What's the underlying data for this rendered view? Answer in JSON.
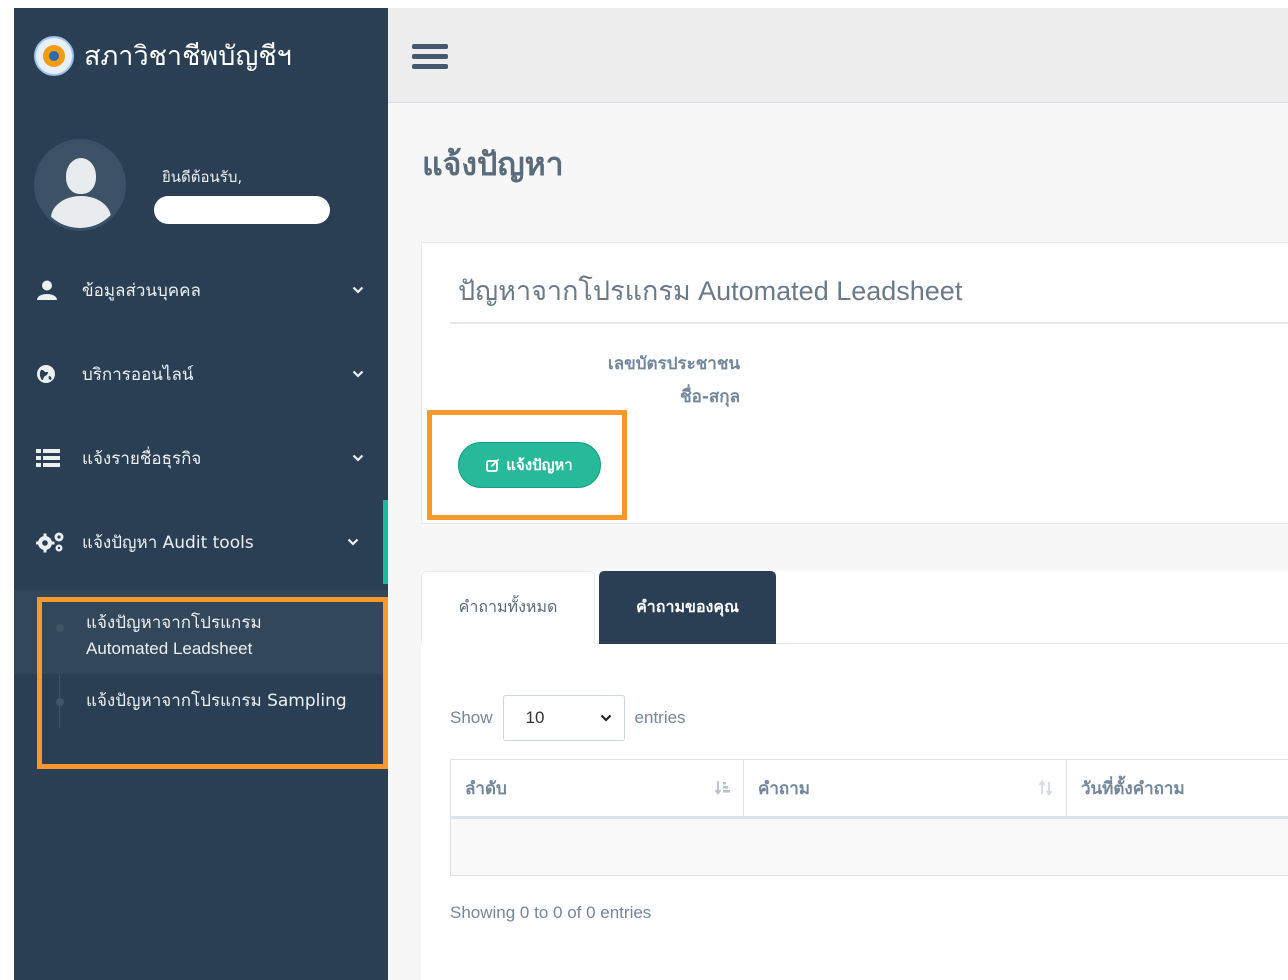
{
  "app": {
    "brand_title": "สภาวิชาชีพบัญชีฯ",
    "brand_icon": "logo-icon"
  },
  "profile": {
    "welcome": "ยินดีต้อนรับ,"
  },
  "sidebar": {
    "items": [
      {
        "label": "ข้อมูลส่วนบุคคล",
        "icon": "user-icon"
      },
      {
        "label": "บริการออนไลน์",
        "icon": "globe-icon"
      },
      {
        "label": "แจ้งรายชื่อธุรกิจ",
        "icon": "list-icon"
      },
      {
        "label": "แจ้งปัญหา Audit tools",
        "icon": "cogs-icon"
      }
    ],
    "submenu": [
      {
        "label_line1": "แจ้งปัญหาจากโปรแกรม",
        "label_line2": "Automated Leadsheet"
      },
      {
        "label": "แจ้งปัญหาจากโปรแกรม Sampling"
      }
    ]
  },
  "main": {
    "page_title": "แจ้งปัญหา",
    "panel_title": "ปัญหาจากโปรแกรม Automated Leadsheet",
    "field_id_label": "เลขบัตรประชาชน",
    "field_name_label": "ชื่อ-สกุล",
    "report_button": "แจ้งปัญหา"
  },
  "tabs": [
    {
      "label": "คำถามทั้งหมด"
    },
    {
      "label": "คำถามของคุณ"
    }
  ],
  "table": {
    "show_label": "Show",
    "entries_value": "10",
    "entries_label": "entries",
    "columns": [
      "ลำดับ",
      "คำถาม",
      "วันที่ตั้งคำถาม"
    ],
    "info": "Showing 0 to 0 of 0 entries"
  },
  "colors": {
    "sidebar_bg": "#2a3f54",
    "accent": "#26b99a",
    "highlight": "#f7992a"
  }
}
